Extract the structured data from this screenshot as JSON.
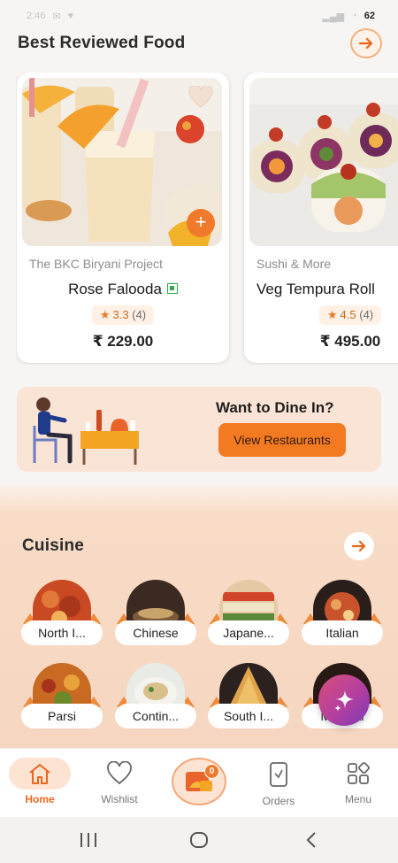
{
  "status_bar": {
    "time": "2:46",
    "battery": "62"
  },
  "best_reviewed": {
    "title": "Best Reviewed Food",
    "items": [
      {
        "restaurant": "The BKC Biryani Project",
        "dish": "Rose Falooda",
        "veg": true,
        "rating": "3.3",
        "reviews": "(4)",
        "price": "₹ 229.00"
      },
      {
        "restaurant": "Sushi & More",
        "dish": "Veg Tempura Roll",
        "veg": true,
        "rating": "4.5",
        "reviews": "(4)",
        "price": "₹ 495.00"
      }
    ]
  },
  "dine_in": {
    "title": "Want to Dine In?",
    "button": "View Restaurants"
  },
  "cuisine": {
    "title": "Cuisine",
    "items": [
      {
        "label": "North I..."
      },
      {
        "label": "Chinese"
      },
      {
        "label": "Japane..."
      },
      {
        "label": "Italian"
      },
      {
        "label": "Parsi"
      },
      {
        "label": "Contin..."
      },
      {
        "label": "South I..."
      },
      {
        "label": "Mughlai"
      }
    ]
  },
  "bottom_nav": {
    "home": "Home",
    "wishlist": "Wishlist",
    "cart_count": "0",
    "orders": "Orders",
    "menu": "Menu"
  },
  "colors": {
    "accent": "#f07a2c",
    "accent_light": "#fde3d2",
    "banner": "#fae4d6",
    "veg": "#2eac4b"
  }
}
